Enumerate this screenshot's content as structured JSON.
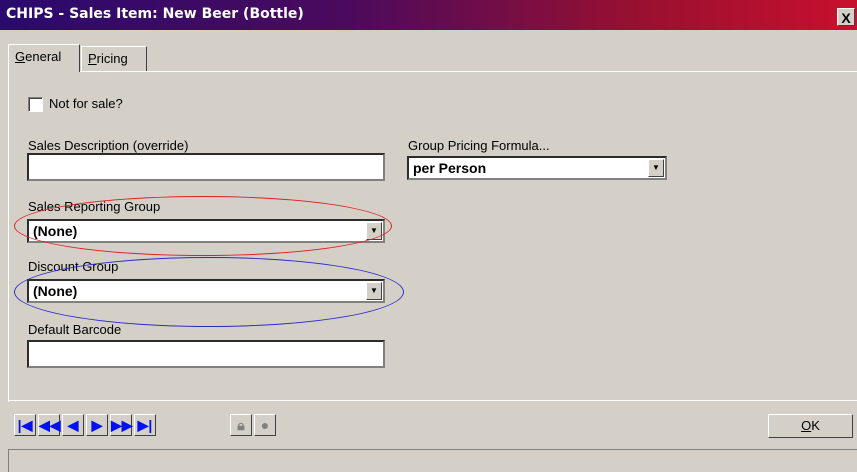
{
  "window": {
    "title": "CHIPS - Sales Item: New Beer (Bottle)",
    "close_label": "X"
  },
  "tabs": [
    {
      "label": "General",
      "underline_letter": "G",
      "rest": "eneral"
    },
    {
      "label": "Pricing",
      "underline_letter": "P",
      "rest": "ricing"
    }
  ],
  "form": {
    "not_for_sale_label": "Not for sale?",
    "sales_description_label": "Sales Description (override)",
    "sales_description_value": "",
    "group_pricing_label": "Group Pricing Formula...",
    "group_pricing_value": "per Person",
    "sales_reporting_label": "Sales Reporting Group",
    "sales_reporting_value": "(None)",
    "discount_group_label": "Discount Group",
    "discount_group_value": "(None)",
    "default_barcode_label": "Default Barcode",
    "default_barcode_value": ""
  },
  "toolbar": {
    "ok_label": "OK",
    "ok_underline": "O",
    "ok_rest": "K"
  },
  "colors": {
    "highlight_red": "#e02020",
    "highlight_blue": "#2a2ad0",
    "nav_blue": "#0010f0"
  }
}
